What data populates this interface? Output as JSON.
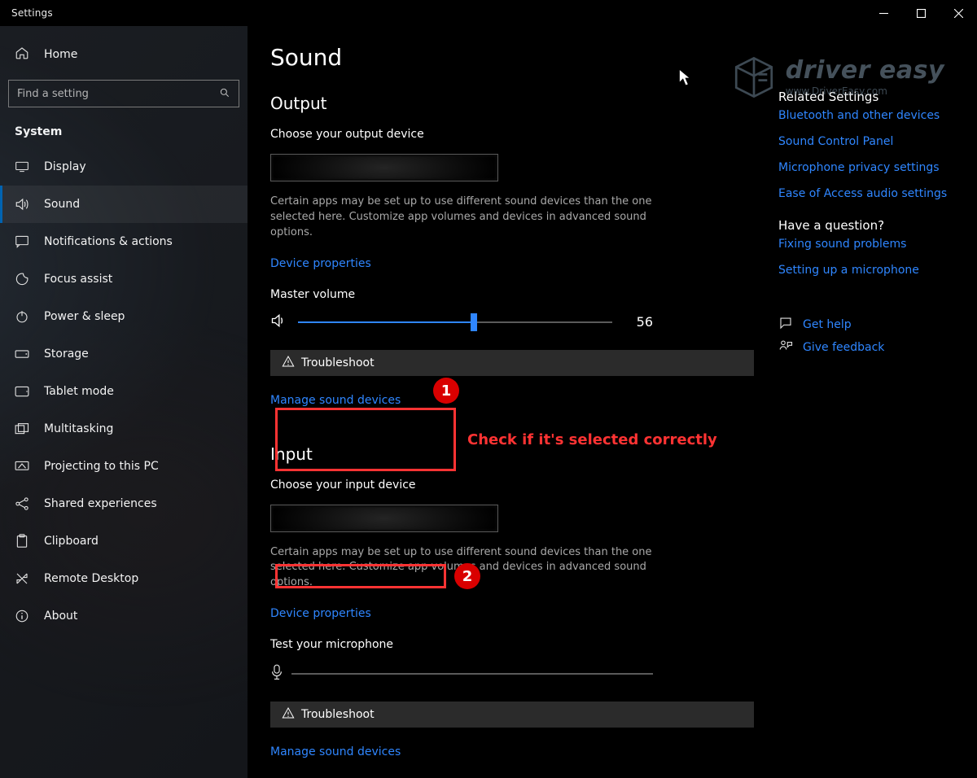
{
  "window": {
    "title": "Settings"
  },
  "sidebar": {
    "home": "Home",
    "search_placeholder": "Find a setting",
    "section": "System",
    "items": [
      {
        "label": "Display",
        "icon": "display-icon"
      },
      {
        "label": "Sound",
        "icon": "sound-icon",
        "selected": true
      },
      {
        "label": "Notifications & actions",
        "icon": "notifications-icon"
      },
      {
        "label": "Focus assist",
        "icon": "focus-assist-icon"
      },
      {
        "label": "Power & sleep",
        "icon": "power-icon"
      },
      {
        "label": "Storage",
        "icon": "storage-icon"
      },
      {
        "label": "Tablet mode",
        "icon": "tablet-icon"
      },
      {
        "label": "Multitasking",
        "icon": "multitasking-icon"
      },
      {
        "label": "Projecting to this PC",
        "icon": "projecting-icon"
      },
      {
        "label": "Shared experiences",
        "icon": "shared-experiences-icon"
      },
      {
        "label": "Clipboard",
        "icon": "clipboard-icon"
      },
      {
        "label": "Remote Desktop",
        "icon": "remote-desktop-icon"
      },
      {
        "label": "About",
        "icon": "about-icon"
      }
    ]
  },
  "page": {
    "title": "Sound",
    "output": {
      "heading": "Output",
      "choose_label": "Choose your output device",
      "desc": "Certain apps may be set up to use different sound devices than the one selected here. Customize app volumes and devices in advanced sound options.",
      "device_properties": "Device properties",
      "master_label": "Master volume",
      "master_value": "56",
      "master_percent": 56,
      "troubleshoot": "Troubleshoot",
      "manage": "Manage sound devices"
    },
    "input": {
      "heading": "Input",
      "choose_label": "Choose your input device",
      "desc": "Certain apps may be set up to use different sound devices than the one selected here. Customize app volumes and devices in advanced sound options.",
      "device_properties": "Device properties",
      "test_label": "Test your microphone",
      "troubleshoot": "Troubleshoot",
      "manage": "Manage sound devices"
    }
  },
  "right": {
    "related": "Related Settings",
    "links": [
      "Bluetooth and other devices",
      "Sound Control Panel",
      "Microphone privacy settings",
      "Ease of Access audio settings"
    ],
    "question": "Have a question?",
    "qlinks": [
      "Fixing sound problems",
      "Setting up a microphone"
    ],
    "help": "Get help",
    "feedback": "Give feedback"
  },
  "watermark": {
    "brand": "driver easy",
    "site": "www.DriverEasy.com"
  },
  "annotations": {
    "circle1": "1",
    "circle2": "2",
    "text": "Check if it's selected correctly"
  }
}
